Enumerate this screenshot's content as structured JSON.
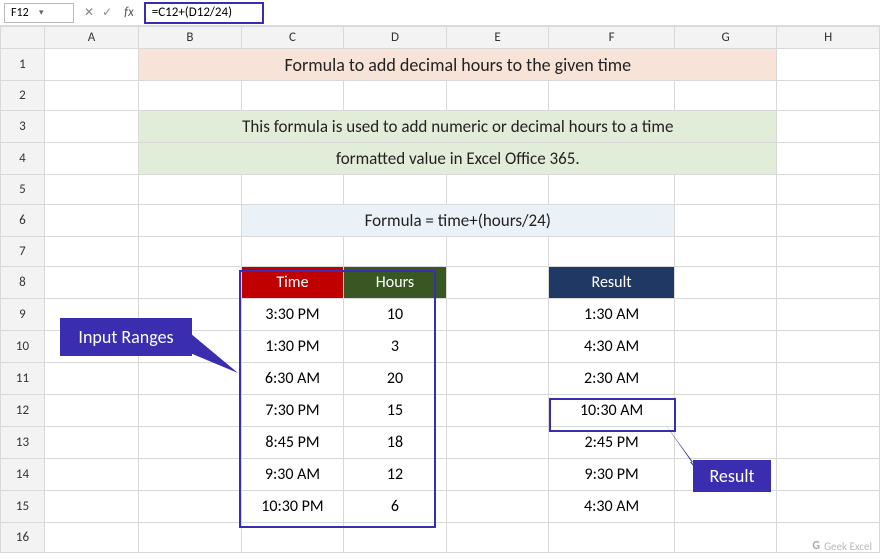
{
  "name_box": "F12",
  "formula_bar": "=C12+(D12/24)",
  "columns": [
    "A",
    "B",
    "C",
    "D",
    "E",
    "F",
    "G",
    "H"
  ],
  "rows": [
    "1",
    "2",
    "3",
    "4",
    "5",
    "6",
    "7",
    "8",
    "9",
    "10",
    "11",
    "12",
    "13",
    "14",
    "15",
    "16"
  ],
  "title": "Formula to add decimal hours to the given time",
  "description_line1": "This formula is used to add numeric or decimal hours to a time",
  "description_line2": "formatted value in Excel Office 365.",
  "formula_text": "Formula = time+(hours/24)",
  "headers": {
    "time": "Time",
    "hours": "Hours",
    "result": "Result"
  },
  "data": {
    "time": [
      "3:30 PM",
      "1:30 PM",
      "6:30 AM",
      "7:30 PM",
      "8:45 PM",
      "9:30 AM",
      "10:30 PM"
    ],
    "hours": [
      "10",
      "3",
      "20",
      "15",
      "18",
      "12",
      "6"
    ],
    "result": [
      "1:30 AM",
      "4:30 AM",
      "2:30 AM",
      "10:30 AM",
      "2:45 PM",
      "9:30 PM",
      "4:30 AM"
    ]
  },
  "callouts": {
    "input": "Input Ranges",
    "result": "Result"
  },
  "watermark": "Geek Excel",
  "fx_label": "fx",
  "selected_cell": "F12"
}
